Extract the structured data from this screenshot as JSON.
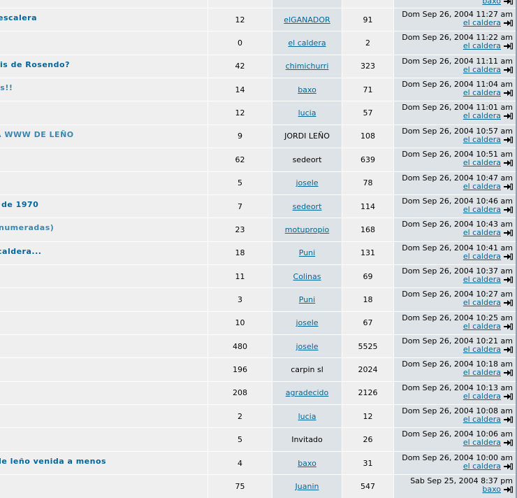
{
  "partial_top_row": {
    "last_user": "baxo"
  },
  "topics": [
    {
      "title": "escalera",
      "title_style": "link",
      "replies": "12",
      "author": "elGANADOR",
      "author_linked": true,
      "views": "91",
      "last_post_date": "Dom Sep 26, 2004 11:27 am",
      "last_post_user": "el caldera"
    },
    {
      "title": "",
      "title_style": "link",
      "replies": "0",
      "author": "el caldera",
      "author_linked": true,
      "views": "2",
      "last_post_date": "Dom Sep 26, 2004 11:22 am",
      "last_post_user": "el caldera"
    },
    {
      "title": "mis de Rosendo?",
      "title_style": "link",
      "replies": "42",
      "author": "chimichurri",
      "author_linked": true,
      "views": "323",
      "last_post_date": "Dom Sep 26, 2004 11:11 am",
      "last_post_user": "el caldera"
    },
    {
      "title": "is!!",
      "title_style": "faded",
      "replies": "14",
      "author": "baxo",
      "author_linked": true,
      "views": "71",
      "last_post_date": "Dom Sep 26, 2004 11:04 am",
      "last_post_user": "el caldera"
    },
    {
      "title": "",
      "title_style": "link",
      "replies": "12",
      "author": "lucia",
      "author_linked": true,
      "views": "57",
      "last_post_date": "Dom Sep 26, 2004 11:01 am",
      "last_post_user": "el caldera"
    },
    {
      "title": "A WWW DE LEÑO",
      "title_style": "faded",
      "replies": "9",
      "author": "JORDI LEÑO",
      "author_linked": false,
      "views": "108",
      "last_post_date": "Dom Sep 26, 2004 10:57 am",
      "last_post_user": "el caldera"
    },
    {
      "title": "",
      "title_style": "link",
      "replies": "62",
      "author": "sedeort",
      "author_linked": false,
      "views": "639",
      "last_post_date": "Dom Sep 26, 2004 10:51 am",
      "last_post_user": "el caldera"
    },
    {
      "title": "",
      "title_style": "link",
      "replies": "5",
      "author": "josele",
      "author_linked": true,
      "views": "78",
      "last_post_date": "Dom Sep 26, 2004 10:47 am",
      "last_post_user": "el caldera"
    },
    {
      "title": "de 1970",
      "title_style": "link",
      "replies": "7",
      "author": "sedeort",
      "author_linked": true,
      "views": "114",
      "last_post_date": "Dom Sep 26, 2004 10:46 am",
      "last_post_user": "el caldera"
    },
    {
      "title": "numeradas)",
      "title_style": "faded",
      "replies": "23",
      "author": "motupropio",
      "author_linked": true,
      "views": "168",
      "last_post_date": "Dom Sep 26, 2004 10:43 am",
      "last_post_user": "el caldera"
    },
    {
      "title": "caldera...",
      "title_style": "link",
      "replies": "18",
      "author": "Puni",
      "author_linked": true,
      "views": "131",
      "last_post_date": "Dom Sep 26, 2004 10:41 am",
      "last_post_user": "el caldera"
    },
    {
      "title": "",
      "title_style": "link",
      "replies": "11",
      "author": "Colinas",
      "author_linked": true,
      "views": "69",
      "last_post_date": "Dom Sep 26, 2004 10:37 am",
      "last_post_user": "el caldera"
    },
    {
      "title": "",
      "title_style": "link",
      "replies": "3",
      "author": "Puni",
      "author_linked": true,
      "views": "18",
      "last_post_date": "Dom Sep 26, 2004 10:27 am",
      "last_post_user": "el caldera"
    },
    {
      "title": "",
      "title_style": "link",
      "replies": "10",
      "author": "josele",
      "author_linked": true,
      "views": "67",
      "last_post_date": "Dom Sep 26, 2004 10:25 am",
      "last_post_user": "el caldera"
    },
    {
      "title": "",
      "title_style": "link",
      "replies": "480",
      "author": "josele",
      "author_linked": true,
      "views": "5525",
      "last_post_date": "Dom Sep 26, 2004 10:21 am",
      "last_post_user": "el caldera"
    },
    {
      "title": "",
      "title_style": "link",
      "replies": "196",
      "author": "carpin sl",
      "author_linked": false,
      "views": "2024",
      "last_post_date": "Dom Sep 26, 2004 10:18 am",
      "last_post_user": "el caldera"
    },
    {
      "title": "",
      "title_style": "link",
      "replies": "208",
      "author": "agradecido",
      "author_linked": true,
      "views": "2126",
      "last_post_date": "Dom Sep 26, 2004 10:13 am",
      "last_post_user": "el caldera"
    },
    {
      "title": "",
      "title_style": "link",
      "replies": "2",
      "author": "lucia",
      "author_linked": true,
      "views": "12",
      "last_post_date": "Dom Sep 26, 2004 10:08 am",
      "last_post_user": "el caldera"
    },
    {
      "title": "",
      "title_style": "link",
      "replies": "5",
      "author": "Invitado",
      "author_linked": false,
      "views": "26",
      "last_post_date": "Dom Sep 26, 2004 10:06 am",
      "last_post_user": "el caldera"
    },
    {
      "title": "de leño venida a menos",
      "title_style": "link",
      "replies": "4",
      "author": "baxo",
      "author_linked": true,
      "views": "31",
      "last_post_date": "Dom Sep 26, 2004 10:00 am",
      "last_post_user": "el caldera"
    },
    {
      "title": "",
      "title_style": "link",
      "replies": "75",
      "author": "Juanin",
      "author_linked": true,
      "views": "547",
      "last_post_date": "Sab Sep 25, 2004 8:37 pm",
      "last_post_user": "baxo"
    }
  ],
  "icons": {
    "last_post": "go-to-last-post-icon"
  },
  "colors": {
    "link": "#006699",
    "row_light": "#efefef",
    "row_dark": "#dee3e7",
    "faded_link": "#3a87b0",
    "border": "#8a9fb4"
  }
}
